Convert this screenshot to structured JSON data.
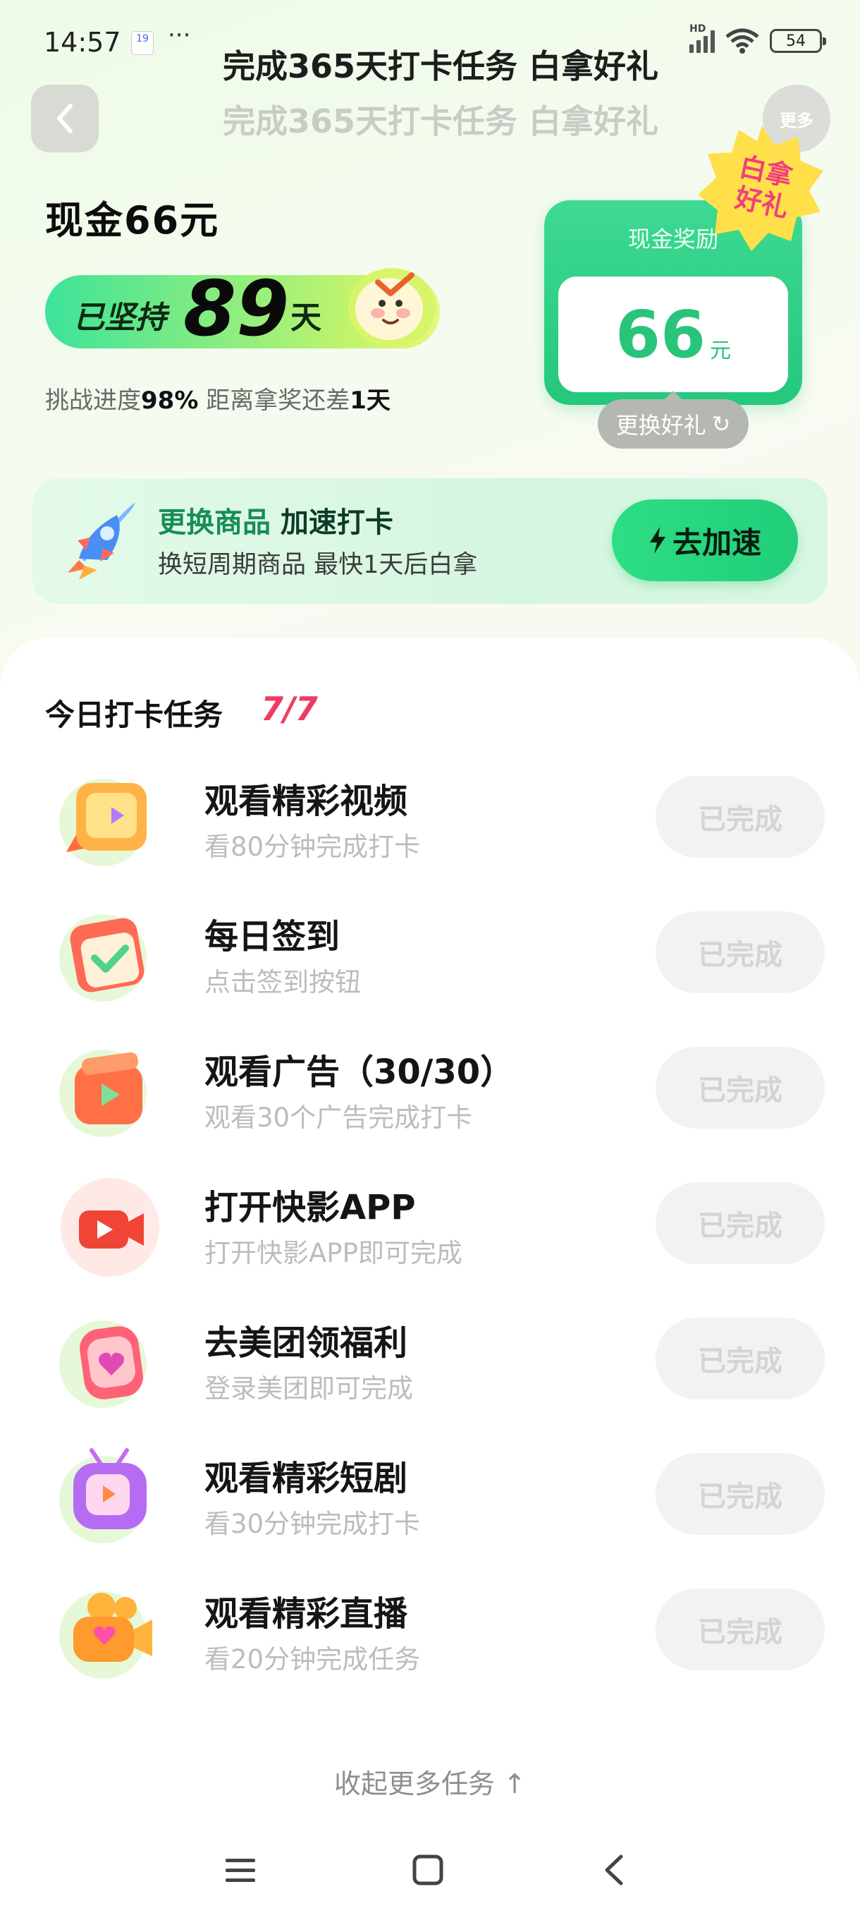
{
  "status_bar": {
    "time": "14:57",
    "calendar_badge": "19",
    "more_dots": "···",
    "network_label": "HD",
    "battery": "54"
  },
  "header": {
    "title": "完成365天打卡任务 白拿好礼",
    "title_echo": "完成365天打卡任务 白拿好礼",
    "more_label": "更多"
  },
  "hero": {
    "cash_title": "现金66元",
    "streak_prefix": "已坚持",
    "streak_days": "89",
    "streak_suffix": "天",
    "progress_label": "挑战进度",
    "progress_value": "98%",
    "remaining_label": "距离拿奖还差",
    "remaining_value": "1天"
  },
  "reward_card": {
    "label": "现金奖励",
    "amount": "66",
    "unit": "元",
    "badge_line1": "白拿",
    "badge_line2": "好礼",
    "change_label": "更换好礼",
    "change_icon": "↻"
  },
  "promo": {
    "title_part1": "更换商品",
    "title_part2": " 加速打卡",
    "subtitle": "换短周期商品 最快1天后白拿",
    "button_label": "去加速"
  },
  "tasks": {
    "title": "今日打卡任务",
    "count": "7/7",
    "done_label": "已完成",
    "items": [
      {
        "title": "观看精彩视频",
        "subtitle": "看80分钟完成打卡",
        "icon": "video-icon"
      },
      {
        "title": "每日签到",
        "subtitle": "点击签到按钮",
        "icon": "calendar-check-icon"
      },
      {
        "title": "观看广告（30/30）",
        "subtitle": "观看30个广告完成打卡",
        "icon": "ad-play-icon"
      },
      {
        "title": "打开快影APP",
        "subtitle": "打开快影APP即可完成",
        "icon": "camera-app-icon"
      },
      {
        "title": "去美团领福利",
        "subtitle": "登录美团即可完成",
        "icon": "heart-watch-icon"
      },
      {
        "title": "观看精彩短剧",
        "subtitle": "看30分钟完成打卡",
        "icon": "tv-icon"
      },
      {
        "title": "观看精彩直播",
        "subtitle": "看20分钟完成任务",
        "icon": "live-camera-icon"
      }
    ],
    "collapse_label": "收起更多任务 ↑"
  },
  "colors": {
    "accent_green": "#28c47a",
    "count_red": "#ee3d62"
  }
}
